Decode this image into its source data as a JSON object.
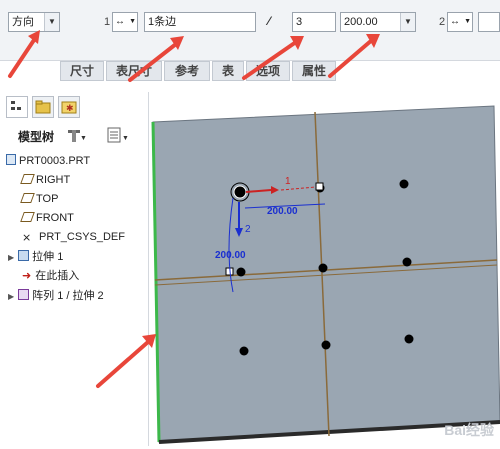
{
  "toolbar": {
    "direction_label": "方向",
    "group1_index": "1",
    "group1_count": "1条边",
    "group2_value": "3",
    "group2_spacing": "200.00",
    "group3_index": "2"
  },
  "tabs": [
    {
      "label": "尺寸"
    },
    {
      "label": "表尺寸"
    },
    {
      "label": "参考"
    },
    {
      "label": "表"
    },
    {
      "label": "选项"
    },
    {
      "label": "属性"
    }
  ],
  "panel": {
    "model_tree_label": "模型树"
  },
  "tree": {
    "root": "PRT0003.PRT",
    "items": [
      {
        "label": "RIGHT"
      },
      {
        "label": "TOP"
      },
      {
        "label": "FRONT"
      },
      {
        "label": "PRT_CSYS_DEF"
      },
      {
        "label": "拉伸 1"
      },
      {
        "label": "在此插入"
      },
      {
        "label": "阵列 1 / 拉伸 2"
      }
    ]
  },
  "viewport": {
    "dim1_label": "1",
    "dim1_value": "200.00",
    "dim2_label": "2",
    "dim2_value": "200.00",
    "watermark": "Bai经验"
  },
  "colors": {
    "accent_red": "#e8463a",
    "plate": "#9aa6b2",
    "dimension_blue": "#1a2fd0"
  }
}
